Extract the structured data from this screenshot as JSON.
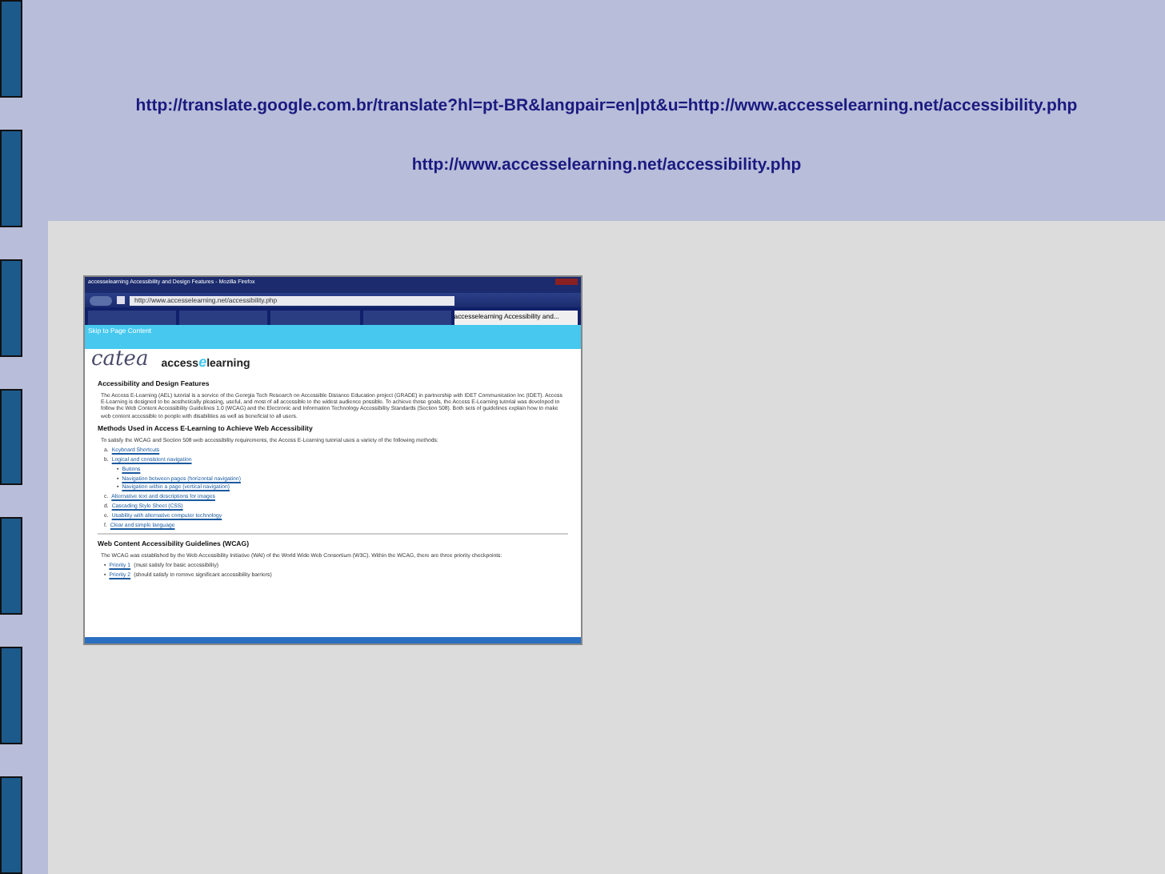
{
  "slide": {
    "links": [
      "http://translate.google.com.br/translate?hl=pt-BR&langpair=en|pt&u=http://www.accesselearning.net/accessibility.php",
      "http://www.accesselearning.net/accessibility.php"
    ]
  },
  "browser": {
    "title": "accesselearning Accessibility and Design Features - Mozilla Firefox",
    "address": "http://www.accesselearning.net/accessibility.php",
    "tabs": [
      {
        "selected": false
      },
      {
        "selected": false
      },
      {
        "selected": false
      },
      {
        "selected": false
      },
      {
        "label": "accesselearning Accessibility and...",
        "selected": true
      }
    ],
    "page": {
      "skip_link": "Skip to Page Content",
      "logo": "catea",
      "brand": [
        "access",
        "e",
        "learning"
      ],
      "heading": "Accessibility and Design Features",
      "intro": "The Access E-Learning (AEL) tutorial is a service of the Georgia Tech Research on Accessible Distance Education project (GRADE) in partnership with IDET Communication Inc (IDET). Access E-Learning is designed to be aesthetically pleasing, useful, and most of all accessible to the widest audience possible. To achieve those goals, the Access E-Learning tutorial was developed to follow the Web Content Accessibility Guidelines 1.0 (WCAG) and the Electronic and Information Technology Accessibility Standards (Section 508). Both sets of guidelines explain how to make web content accessible to people with disabilities as well as beneficial to all users.",
      "methods_heading": "Methods Used in Access E-Learning to Achieve Web Accessibility",
      "methods_intro": "To satisfy the WCAG and Section 508 web accessibility requirements, the Access E-Learning tutorial uses a variety of the following methods:",
      "methods": [
        {
          "marker": "a.",
          "text": "Keyboard Shortcuts"
        },
        {
          "marker": "b.",
          "text": "Logical and consistent navigation",
          "children": [
            {
              "marker": "•",
              "text": "Buttons"
            },
            {
              "marker": "•",
              "text": "Navigation between pages (horizontal navigation)"
            },
            {
              "marker": "•",
              "text": "Navigation within a page (vertical navigation)"
            }
          ]
        },
        {
          "marker": "c.",
          "text": "Alternative text and descriptions for images"
        },
        {
          "marker": "d.",
          "text": "Cascading Style Sheet (CSS)"
        },
        {
          "marker": "e.",
          "text": "Usability with alternative computer technology"
        },
        {
          "marker": "f.",
          "text": "Clear and simple language"
        }
      ],
      "wcag_heading": "Web Content Accessibility Guidelines (WCAG)",
      "wcag_intro": "The WCAG was established by the Web Accessibility Initiative (WAI) of the World Wide Web Consortium (W3C). Within the WCAG, there are three priority checkpoints:",
      "priorities": [
        {
          "marker": "•",
          "link": "Priority 1",
          "text": "(must satisfy for basic accessibility)"
        },
        {
          "marker": "•",
          "link": "Priority 2",
          "text": "(should satisfy to remove significant accessibility barriers)"
        }
      ]
    }
  }
}
